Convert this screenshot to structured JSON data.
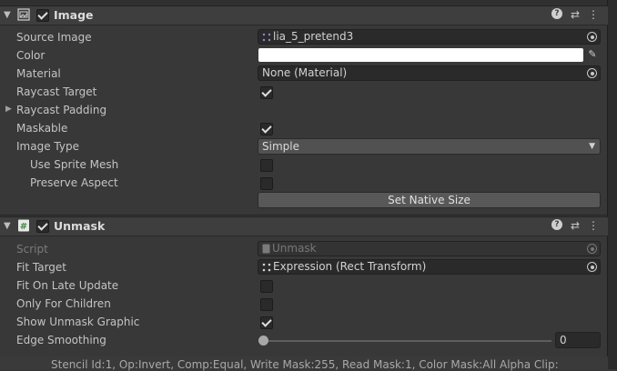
{
  "image_component": {
    "title": "Image",
    "enabled": true,
    "rows": {
      "source_image_label": "Source Image",
      "source_image_value": "lia_5_pretend3",
      "color_label": "Color",
      "material_label": "Material",
      "material_value": "None (Material)",
      "raycast_target_label": "Raycast Target",
      "raycast_target_checked": true,
      "raycast_padding_label": "Raycast Padding",
      "maskable_label": "Maskable",
      "maskable_checked": true,
      "image_type_label": "Image Type",
      "image_type_value": "Simple",
      "use_sprite_mesh_label": "Use Sprite Mesh",
      "use_sprite_mesh_checked": false,
      "preserve_aspect_label": "Preserve Aspect",
      "preserve_aspect_checked": false,
      "set_native_size_label": "Set Native Size"
    },
    "color_value": "#ffffff"
  },
  "unmask_component": {
    "title": "Unmask",
    "enabled": true,
    "rows": {
      "script_label": "Script",
      "script_value": "Unmask",
      "fit_target_label": "Fit Target",
      "fit_target_value": "Expression (Rect Transform)",
      "fit_on_late_update_label": "Fit On Late Update",
      "fit_on_late_update_checked": false,
      "only_for_children_label": "Only For Children",
      "only_for_children_checked": false,
      "show_unmask_graphic_label": "Show Unmask Graphic",
      "show_unmask_graphic_checked": true,
      "edge_smoothing_label": "Edge Smoothing",
      "edge_smoothing_value": "0"
    }
  },
  "footer_text": "Stencil Id:1, Op:Invert, Comp:Equal, Write Mask:255, Read Mask:1, Color Mask:All Alpha Clip:",
  "icons": [
    "fold-arrow-icon",
    "image-component-icon",
    "script-component-icon",
    "help-icon",
    "preset-icon",
    "more-icon",
    "object-picker-icon",
    "eyedropper-icon",
    "dropdown-arrow-icon",
    "sprite-icon",
    "script-file-icon",
    "rect-transform-icon"
  ]
}
